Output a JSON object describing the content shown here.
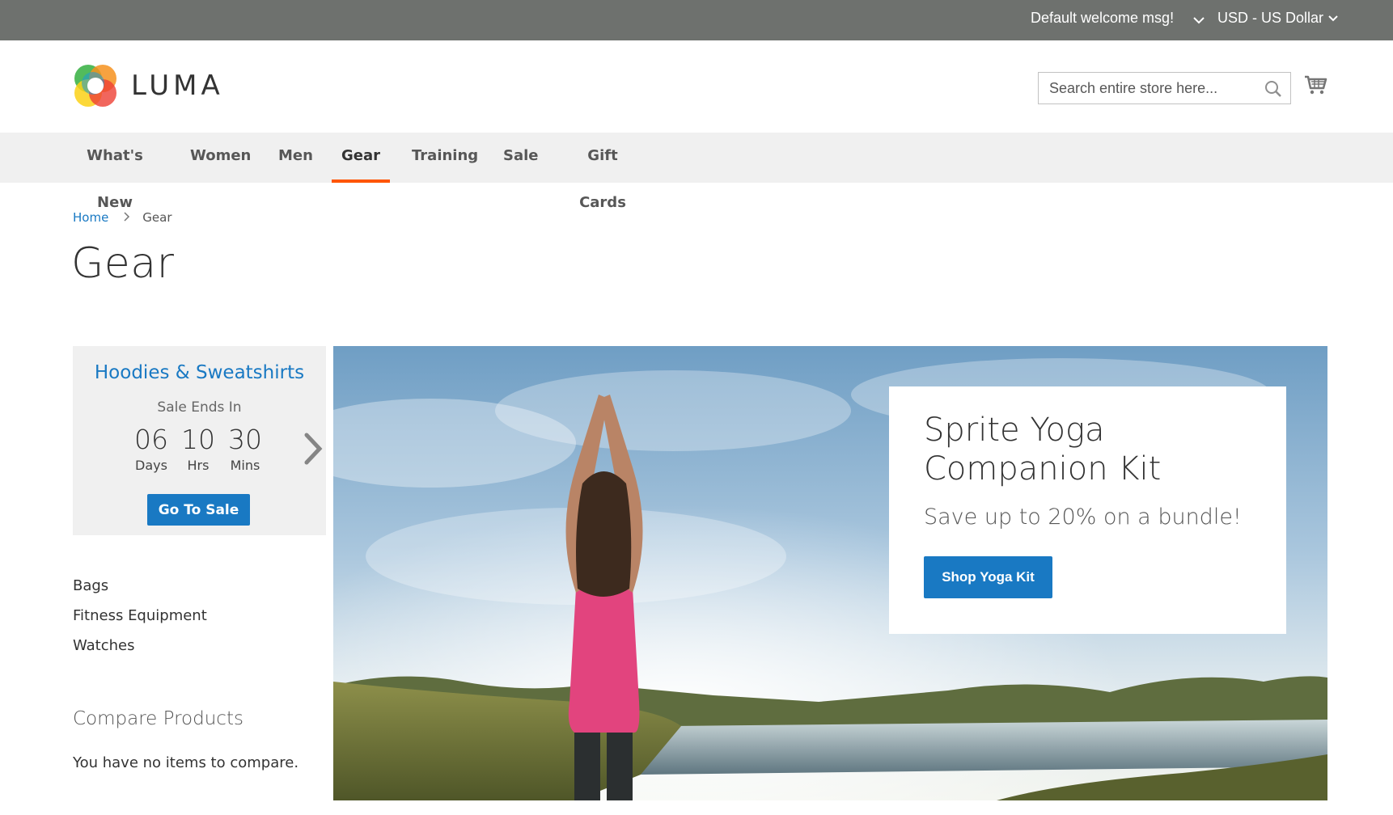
{
  "top_bar": {
    "welcome": "Default welcome msg!",
    "currency": "USD - US Dollar"
  },
  "header": {
    "logo_text": "LUMA",
    "search_placeholder": "Search entire store here...",
    "search_value": ""
  },
  "nav": {
    "items": [
      {
        "label": "What's New"
      },
      {
        "label": "Women"
      },
      {
        "label": "Men"
      },
      {
        "label": "Gear",
        "active": true
      },
      {
        "label": "Training"
      },
      {
        "label": "Sale"
      },
      {
        "label": "Gift Cards"
      }
    ]
  },
  "breadcrumb": {
    "home": "Home",
    "current": "Gear"
  },
  "page_title": "Gear",
  "promo": {
    "title": "Hoodies & Sweatshirts",
    "subtitle": "Sale Ends In",
    "countdown": [
      {
        "value": "06",
        "unit": "Days"
      },
      {
        "value": "10",
        "unit": "Hrs"
      },
      {
        "value": "30",
        "unit": "Mins"
      }
    ],
    "button": "Go To Sale"
  },
  "categories": [
    "Bags",
    "Fitness Equipment",
    "Watches"
  ],
  "compare": {
    "title": "Compare Products",
    "empty": "You have no items to compare."
  },
  "hero": {
    "title": "Sprite Yoga Companion Kit",
    "subtitle": "Save up to 20% on a bundle!",
    "button": "Shop Yoga Kit"
  },
  "colors": {
    "top_bar": "#6e716e",
    "link": "#1979c3",
    "button": "#1979c3",
    "nav_active_underline": "#ff5501",
    "nav_background": "#f0f0f0"
  }
}
